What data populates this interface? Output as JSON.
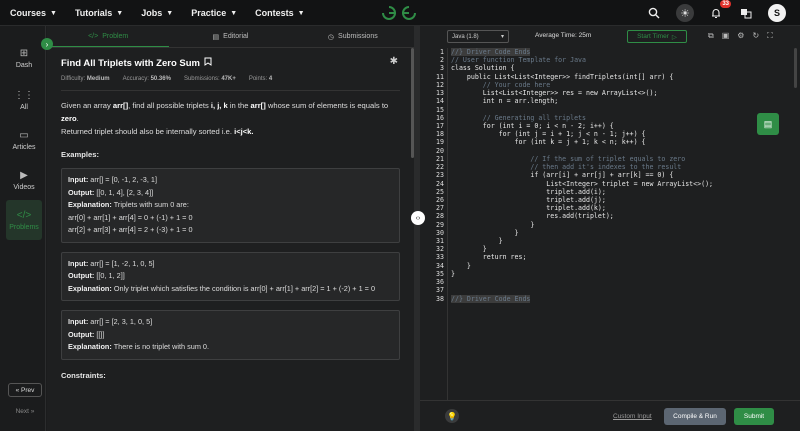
{
  "nav": [
    {
      "label": "Courses"
    },
    {
      "label": "Tutorials"
    },
    {
      "label": "Jobs"
    },
    {
      "label": "Practice"
    },
    {
      "label": "Contests"
    }
  ],
  "logo_text": "GG",
  "notifications_count": "33",
  "avatar_letter": "S",
  "sidebar": [
    {
      "label": "Dash",
      "icon": "dash-icon"
    },
    {
      "label": "All",
      "icon": "grid-icon"
    },
    {
      "label": "Articles",
      "icon": "book-icon"
    },
    {
      "label": "Videos",
      "icon": "video-icon"
    },
    {
      "label": "Problems",
      "icon": "code-icon"
    }
  ],
  "prev_label": "« Prev",
  "next_label": "Next »",
  "tabs": [
    {
      "label": "Problem",
      "icon": "</>"
    },
    {
      "label": "Editorial",
      "icon": "▤"
    },
    {
      "label": "Submissions",
      "icon": "◷"
    }
  ],
  "problem": {
    "title": "Find All Triplets with Zero Sum",
    "difficulty_label": "Difficulty:",
    "difficulty": "Medium",
    "accuracy_label": "Accuracy:",
    "accuracy": "50.36%",
    "submissions_label": "Submissions:",
    "submissions": "47K+",
    "points_label": "Points:",
    "points": "4",
    "desc1": "Given an array ",
    "desc_arr": "arr[]",
    "desc2": ", find all possible triplets ",
    "desc_ijk": "i, j, k",
    "desc3": " in the ",
    "desc_arr2": "arr[]",
    "desc4": " whose sum of elements is equals to ",
    "desc_zero": "zero",
    "desc5": ".",
    "desc6": "Returned triplet should also be internally sorted i.e. ",
    "desc_cond": "i<j<k.",
    "examples_heading": "Examples:",
    "constraints_heading": "Constraints:"
  },
  "examples": [
    {
      "input_label": "Input:",
      "input": "arr[] = [0, -1, 2, -3, 1]",
      "output_label": "Output:",
      "output": "[[0, 1, 4], [2, 3, 4]]",
      "expl_label": "Explanation:",
      "expl": "Triplets with sum 0 are:",
      "extra": [
        "arr[0] + arr[1] + arr[4] = 0 + (-1) + 1 = 0",
        "arr[2] + arr[3] + arr[4] = 2 + (-3) + 1 = 0"
      ]
    },
    {
      "input_label": "Input:",
      "input": "arr[] = [1, -2, 1, 0, 5]",
      "output_label": "Output:",
      "output": "[[0, 1, 2]]",
      "expl_label": "Explanation:",
      "expl": "Only triplet which satisfies the condition is arr[0] + arr[1] + arr[2] = 1 + (-2) + 1 = 0",
      "extra": []
    },
    {
      "input_label": "Input:",
      "input": "arr[] = [2, 3, 1, 0, 5]",
      "output_label": "Output:",
      "output": "[[]]",
      "expl_label": "Explanation:",
      "expl": "There is no triplet with sum 0.",
      "extra": []
    }
  ],
  "editor": {
    "language": "Java (1.8)",
    "avg_time": "Average Time: 25m",
    "timer_label": "Start Timer",
    "custom_input": "Custom Input",
    "compile_label": "Compile & Run",
    "submit_label": "Submit",
    "lines": [
      {
        "n": "1",
        "t": "//} Driver Code Ends",
        "c": "#6a7a8a",
        "hl": true
      },
      {
        "n": "2",
        "t": "// User function Template for Java",
        "c": "#6a7a8a"
      },
      {
        "n": "3",
        "t": "class Solution {",
        "c": "#e8e8e8"
      },
      {
        "n": "11",
        "t": "    public List<List<Integer>> findTriplets(int[] arr) {",
        "c": "#e8e8e8"
      },
      {
        "n": "12",
        "t": "        // Your code here",
        "c": "#6a7a8a"
      },
      {
        "n": "13",
        "t": "        List<List<Integer>> res = new ArrayList<>();",
        "c": "#e8e8e8"
      },
      {
        "n": "14",
        "t": "        int n = arr.length;",
        "c": "#e8e8e8"
      },
      {
        "n": "15",
        "t": "",
        "c": "#e8e8e8"
      },
      {
        "n": "16",
        "t": "        // Generating all triplets",
        "c": "#6a7a8a"
      },
      {
        "n": "17",
        "t": "        for (int i = 0; i < n - 2; i++) {",
        "c": "#e8e8e8"
      },
      {
        "n": "18",
        "t": "            for (int j = i + 1; j < n - 1; j++) {",
        "c": "#e8e8e8"
      },
      {
        "n": "19",
        "t": "                for (int k = j + 1; k < n; k++) {",
        "c": "#e8e8e8"
      },
      {
        "n": "20",
        "t": "",
        "c": "#e8e8e8"
      },
      {
        "n": "21",
        "t": "                    // If the sum of triplet equals to zero",
        "c": "#6a7a8a"
      },
      {
        "n": "22",
        "t": "                    // then add it's indexes to the result",
        "c": "#6a7a8a"
      },
      {
        "n": "23",
        "t": "                    if (arr[i] + arr[j] + arr[k] == 0) {",
        "c": "#e8e8e8"
      },
      {
        "n": "24",
        "t": "                        List<Integer> triplet = new ArrayList<>();",
        "c": "#e8e8e8"
      },
      {
        "n": "25",
        "t": "                        triplet.add(i);",
        "c": "#e8e8e8"
      },
      {
        "n": "26",
        "t": "                        triplet.add(j);",
        "c": "#e8e8e8"
      },
      {
        "n": "27",
        "t": "                        triplet.add(k);",
        "c": "#e8e8e8"
      },
      {
        "n": "28",
        "t": "                        res.add(triplet);",
        "c": "#e8e8e8"
      },
      {
        "n": "29",
        "t": "                    }",
        "c": "#e8e8e8"
      },
      {
        "n": "30",
        "t": "                }",
        "c": "#e8e8e8"
      },
      {
        "n": "31",
        "t": "            }",
        "c": "#e8e8e8"
      },
      {
        "n": "32",
        "t": "        }",
        "c": "#e8e8e8"
      },
      {
        "n": "33",
        "t": "        return res;",
        "c": "#e8e8e8"
      },
      {
        "n": "34",
        "t": "    }",
        "c": "#e8e8e8"
      },
      {
        "n": "35",
        "t": "}",
        "c": "#e8e8e8"
      },
      {
        "n": "36",
        "t": "",
        "c": "#e8e8e8"
      },
      {
        "n": "37",
        "t": "",
        "c": "#e8e8e8"
      },
      {
        "n": "38",
        "t": "//} Driver Code Ends",
        "c": "#6a7a8a",
        "hl": true
      }
    ]
  }
}
